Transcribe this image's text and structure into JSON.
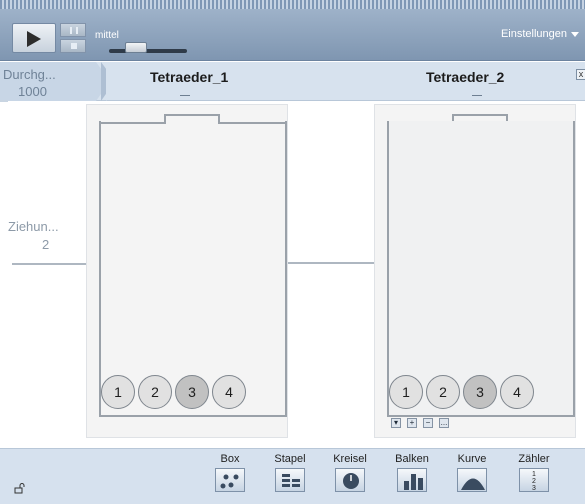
{
  "control_bar": {
    "speed_label": "mittel",
    "settings_label": "Einstellungen",
    "speed_level": 0.3
  },
  "header": {
    "draws_label": "Durchg...",
    "draws_value": "1000",
    "device_1_title": "Tetraeder_1",
    "device_2_title": "Tetraeder_2",
    "close_label": "x"
  },
  "main": {
    "ziehungen_label": "Ziehun...",
    "ziehungen_value": "2",
    "device_1_balls": [
      "1",
      "2",
      "3",
      "4"
    ],
    "device_2_balls": [
      "1",
      "2",
      "3",
      "4"
    ],
    "highlighted_ball": "3",
    "mini_controls": [
      "▾",
      "+",
      "−",
      "..."
    ]
  },
  "toolbar": {
    "tools": [
      "Box",
      "Stapel",
      "Kreisel",
      "Balken",
      "Kurve",
      "Zähler"
    ],
    "counter_icon_digits": [
      "1",
      "2",
      "3"
    ]
  },
  "colors": {
    "control_bar": "#8ea4be",
    "header_bg": "#d7e2ee",
    "ball_fill": "#e1e1e1",
    "ball_highlight": "#c1c1c1",
    "toolbar_bg": "#d6e1ee"
  }
}
